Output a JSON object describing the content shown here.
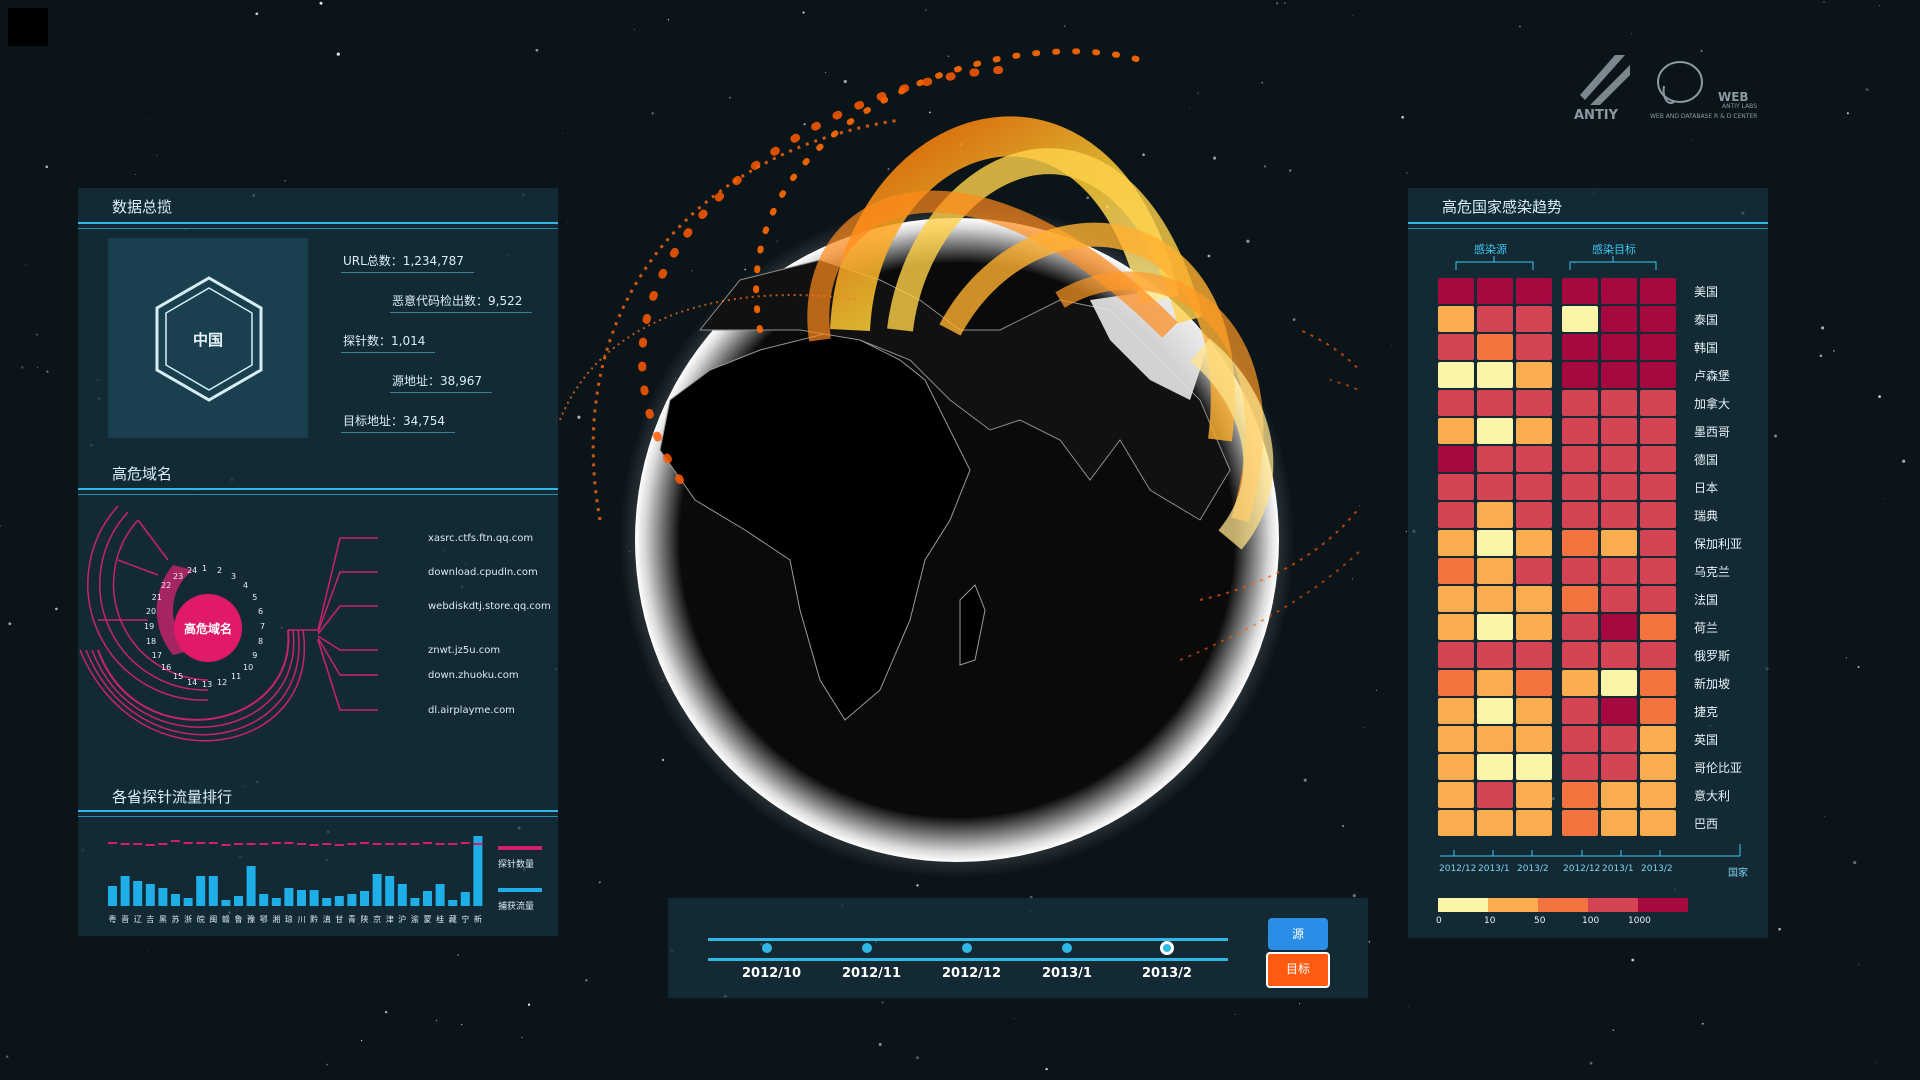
{
  "panels": {
    "overview": {
      "title": "数据总揽",
      "hex_label": "中国",
      "stats": [
        "URL总数：1,234,787",
        "恶意代码检出数：9,522",
        "探针数：1,014",
        "源地址：38,967",
        "目标地址：34,754"
      ]
    },
    "domains": {
      "title": "高危域名",
      "center_label": "高危域名",
      "ring_numbers": [
        "1",
        "2",
        "3",
        "4",
        "5",
        "6",
        "7",
        "8",
        "9",
        "10",
        "11",
        "12",
        "13",
        "14",
        "15",
        "16",
        "17",
        "18",
        "19",
        "20",
        "21",
        "22",
        "23",
        "24"
      ],
      "list": [
        "xasrc.ctfs.ftn.qq.com",
        "download.cpudln.com",
        "webdiskdtj.store.qq.com",
        "znwt.jz5u.com",
        "down.zhuoku.com",
        "dl.airplayme.com"
      ]
    },
    "probe_rank": {
      "title": "各省探针流量排行",
      "legend": [
        "探针数量",
        "捕获流量"
      ],
      "colors": {
        "probe": "#d21f6a",
        "flow": "#1eaee8"
      }
    },
    "infection": {
      "title": "高危国家感染趋势",
      "group_labels": [
        "感染源",
        "感染目标"
      ],
      "x_ticks": [
        "2012/12",
        "2013/1",
        "2013/2",
        "2012/12",
        "2013/1",
        "2013/2"
      ],
      "axis_end_label": "国家",
      "legend_ticks": [
        "0",
        "10",
        "50",
        "100",
        "1000"
      ],
      "legend_colors": [
        "#fbf5a8",
        "#f9ad4f",
        "#f3743f",
        "#d54454",
        "#a5093f"
      ]
    },
    "timeline": {
      "labels": [
        "2012/10",
        "2012/11",
        "2012/12",
        "2013/1",
        "2013/2"
      ],
      "selected": "2013/2",
      "btn_source": "源",
      "btn_target": "目标"
    },
    "logo": {
      "brand": "ANTIY",
      "sub1": "WEB",
      "sub2": "ANTIY LABS",
      "sub3": "WEB AND DATABASE R & D CENTER"
    }
  },
  "chart_data": [
    {
      "type": "bar",
      "title": "各省探针流量排行",
      "categories": [
        "粤",
        "晋",
        "辽",
        "吉",
        "黑",
        "苏",
        "浙",
        "皖",
        "闽",
        "赣",
        "鲁",
        "豫",
        "鄂",
        "湘",
        "琼",
        "川",
        "黔",
        "滇",
        "甘",
        "青",
        "陕",
        "京",
        "津",
        "沪",
        "渝",
        "蒙",
        "桂",
        "藏",
        "宁",
        "新"
      ],
      "series": [
        {
          "name": "探针数量",
          "values": [
            64,
            63,
            63,
            62,
            63,
            66,
            64,
            64,
            64,
            62,
            63,
            63,
            63,
            64,
            64,
            63,
            62,
            63,
            62,
            63,
            64,
            63,
            63,
            63,
            63,
            64,
            63,
            63,
            64,
            63
          ]
        },
        {
          "name": "捕获流量",
          "values": [
            20,
            30,
            25,
            22,
            18,
            12,
            8,
            30,
            30,
            6,
            10,
            40,
            12,
            8,
            18,
            16,
            16,
            8,
            10,
            12,
            15,
            32,
            30,
            22,
            8,
            15,
            22,
            6,
            14,
            70
          ]
        }
      ],
      "ylim": [
        0,
        80
      ]
    },
    {
      "type": "heatmap",
      "title": "高危国家感染趋势",
      "columns": [
        "感染源 2012/12",
        "感染源 2013/1",
        "感染源 2013/2",
        "感染目标 2012/12",
        "感染目标 2013/1",
        "感染目标 2013/2"
      ],
      "rows": [
        "美国",
        "泰国",
        "韩国",
        "卢森堡",
        "加拿大",
        "墨西哥",
        "德国",
        "日本",
        "瑞典",
        "保加利亚",
        "乌克兰",
        "法国",
        "荷兰",
        "俄罗斯",
        "新加坡",
        "捷克",
        "英国",
        "哥伦比亚",
        "意大利",
        "巴西"
      ],
      "levels": [
        [
          5,
          5,
          5,
          5,
          5,
          5
        ],
        [
          2,
          4,
          4,
          1,
          5,
          5
        ],
        [
          4,
          3,
          4,
          5,
          5,
          5
        ],
        [
          1,
          1,
          2,
          5,
          5,
          5
        ],
        [
          4,
          4,
          4,
          4,
          4,
          4
        ],
        [
          2,
          1,
          2,
          4,
          4,
          4
        ],
        [
          5,
          4,
          4,
          4,
          4,
          4
        ],
        [
          4,
          4,
          4,
          4,
          4,
          4
        ],
        [
          4,
          2,
          4,
          4,
          4,
          4
        ],
        [
          2,
          1,
          2,
          3,
          2,
          4
        ],
        [
          3,
          2,
          4,
          4,
          4,
          4
        ],
        [
          2,
          2,
          2,
          3,
          4,
          4
        ],
        [
          2,
          1,
          2,
          4,
          5,
          3
        ],
        [
          4,
          4,
          4,
          4,
          4,
          4
        ],
        [
          3,
          2,
          3,
          2,
          1,
          3
        ],
        [
          2,
          1,
          2,
          4,
          5,
          3
        ],
        [
          2,
          2,
          2,
          4,
          4,
          2
        ],
        [
          2,
          1,
          1,
          4,
          4,
          2
        ],
        [
          2,
          4,
          2,
          3,
          2,
          2
        ],
        [
          2,
          2,
          2,
          3,
          2,
          2
        ]
      ]
    }
  ]
}
